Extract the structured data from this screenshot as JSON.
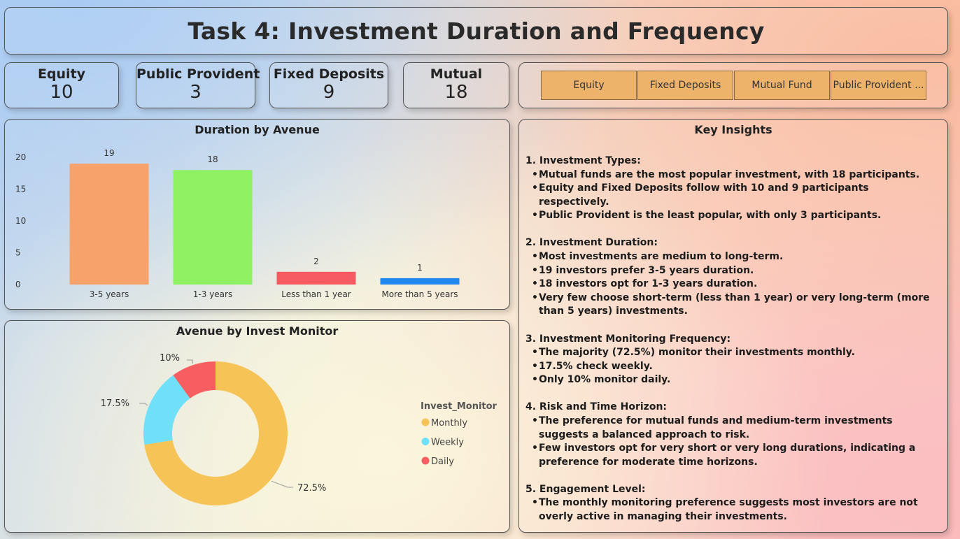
{
  "title": "Task 4: Investment Duration and Frequency",
  "cards": [
    {
      "label": "Equity",
      "value": "10"
    },
    {
      "label": "Public Provident",
      "value": "3"
    },
    {
      "label": "Fixed Deposits",
      "value": "9"
    },
    {
      "label": "Mutual",
      "value": "18"
    }
  ],
  "slicer": {
    "options": [
      "Equity",
      "Fixed Deposits",
      "Mutual Fund",
      "Public Provident ..."
    ],
    "color": "#eeb36b"
  },
  "bar_title": "Duration by Avenue",
  "donut_title": "Avenue by Invest Monitor",
  "chart_data": [
    {
      "type": "bar",
      "title": "Duration by Avenue",
      "categories": [
        "3-5 years",
        "1-3 years",
        "Less than 1 year",
        "More than 5 years"
      ],
      "values": [
        19,
        18,
        2,
        1
      ],
      "colors": [
        "#f7a26a",
        "#8ff062",
        "#f75b62",
        "#1f87ee"
      ],
      "ylim": [
        0,
        20
      ],
      "yticks": [
        0,
        5,
        10,
        15,
        20
      ],
      "grid": false
    },
    {
      "type": "pie",
      "title": "Avenue by Invest Monitor",
      "legend_title": "Invest_Monitor",
      "legend_position": "right",
      "slices": [
        {
          "name": "Monthly",
          "value": 72.5,
          "label": "72.5%",
          "color": "#f6c456"
        },
        {
          "name": "Weekly",
          "value": 17.5,
          "label": "17.5%",
          "color": "#6fe0f8"
        },
        {
          "name": "Daily",
          "value": 10,
          "label": "10%",
          "color": "#f75e62"
        }
      ]
    }
  ],
  "insights": {
    "title": "Key Insights",
    "sections": [
      {
        "heading": "1. Investment Types:",
        "points": [
          "Mutual funds are the most popular investment, with 18 participants.",
          "Equity and Fixed Deposits follow with 10 and 9 participants respectively.",
          "Public Provident is the least popular, with only 3 participants."
        ]
      },
      {
        "heading": "2. Investment Duration:",
        "points": [
          "Most investments are medium to long-term.",
          "19 investors prefer 3-5 years duration.",
          "18 investors opt for 1-3 years duration.",
          "Very few choose short-term (less than 1 year) or very long-term (more than 5 years) investments."
        ]
      },
      {
        "heading": "3. Investment Monitoring Frequency:",
        "points": [
          "The majority (72.5%) monitor their investments monthly.",
          "17.5% check weekly.",
          "Only 10% monitor daily."
        ]
      },
      {
        "heading": "4. Risk and Time Horizon:",
        "points": [
          "The preference for mutual funds and medium-term investments suggests a balanced approach to risk.",
          "Few investors opt for very short or very long durations, indicating a preference for moderate time horizons."
        ]
      },
      {
        "heading": "5. Engagement Level:",
        "points": [
          "The monthly monitoring preference suggests most investors are not overly active in managing their investments."
        ]
      }
    ]
  }
}
